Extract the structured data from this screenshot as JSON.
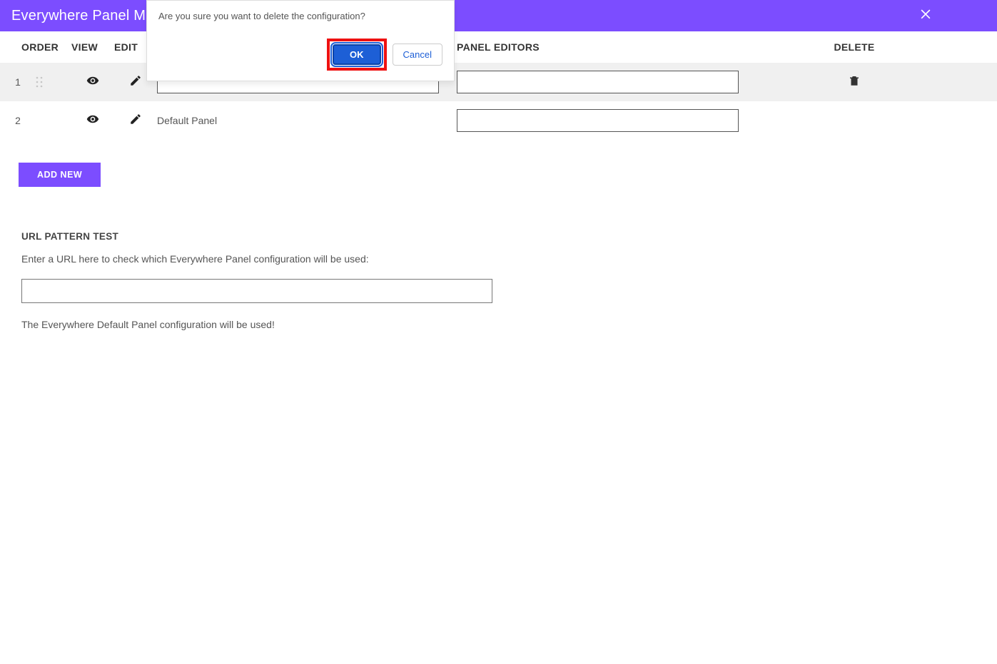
{
  "header": {
    "title": "Everywhere Panel Ma"
  },
  "dialog": {
    "message": "Are you sure you want to delete the configuration?",
    "ok_label": "OK",
    "cancel_label": "Cancel"
  },
  "columns": {
    "order": "ORDER",
    "view": "VIEW",
    "edit": "EDIT",
    "panel_editors": "PANEL EDITORS",
    "delete": "DELETE"
  },
  "rows": [
    {
      "num": "1",
      "label": "",
      "has_drag": true,
      "has_delete": true
    },
    {
      "num": "2",
      "label": "Default Panel",
      "has_drag": false,
      "has_delete": false
    }
  ],
  "buttons": {
    "add_new": "ADD NEW"
  },
  "url_test": {
    "heading": "URL PATTERN TEST",
    "description": "Enter a URL here to check which Everywhere Panel configuration will be used:",
    "result": "The Everywhere Default Panel configuration will be used!"
  }
}
